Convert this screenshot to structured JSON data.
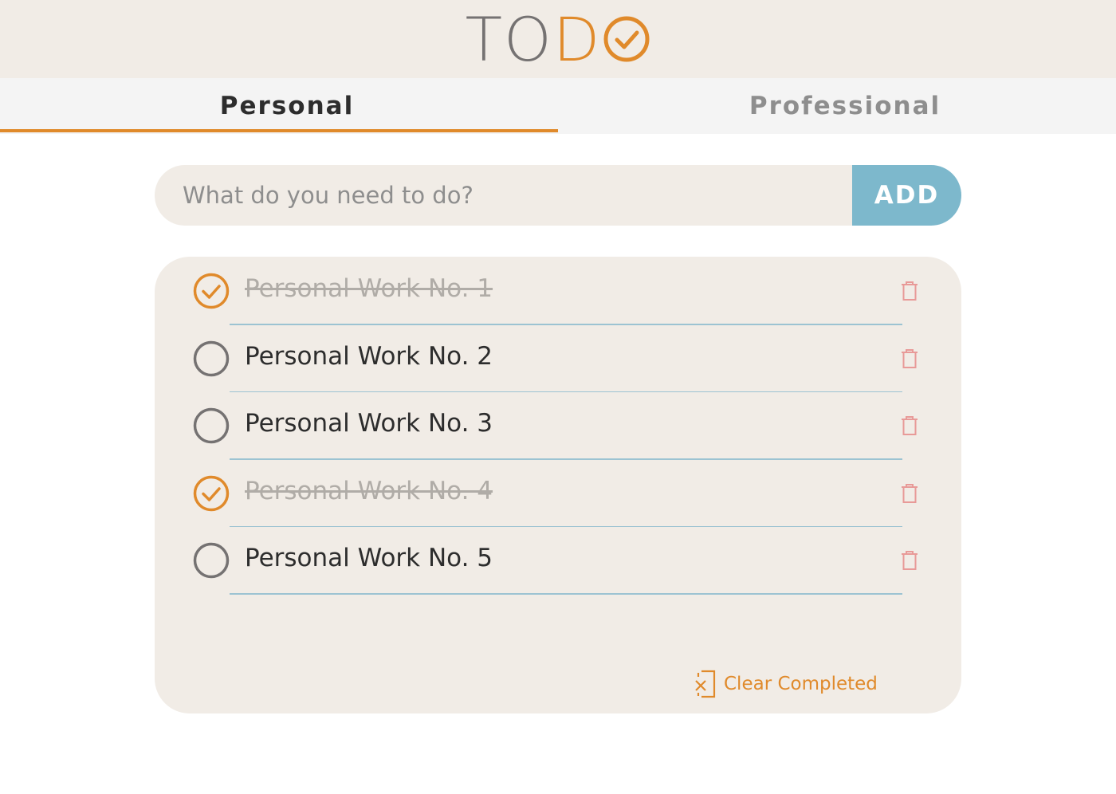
{
  "header": {
    "logo_to": "TO",
    "logo_d": "D"
  },
  "tabs": [
    {
      "label": "Personal",
      "active": true
    },
    {
      "label": "Professional",
      "active": false
    }
  ],
  "add_form": {
    "placeholder": "What do you need to do?",
    "value": "",
    "button_label": "ADD"
  },
  "todos": [
    {
      "text": "Personal Work No. 1",
      "completed": true
    },
    {
      "text": "Personal Work No. 2",
      "completed": false
    },
    {
      "text": "Personal Work No. 3",
      "completed": false
    },
    {
      "text": "Personal Work No. 4",
      "completed": true
    },
    {
      "text": "Personal Work No. 5",
      "completed": false
    }
  ],
  "footer": {
    "clear_label": "Clear Completed"
  },
  "colors": {
    "accent": "#e08a2b",
    "add_button": "#7db8cc",
    "panel_bg": "#f1ece6",
    "trash": "#e89a98",
    "divider": "#9cc3d2"
  },
  "icons": {
    "logo_o": "check-circle-icon",
    "completed": "check-circle-icon",
    "pending": "empty-circle-icon",
    "delete": "trash-icon",
    "clear": "clear-document-icon"
  }
}
